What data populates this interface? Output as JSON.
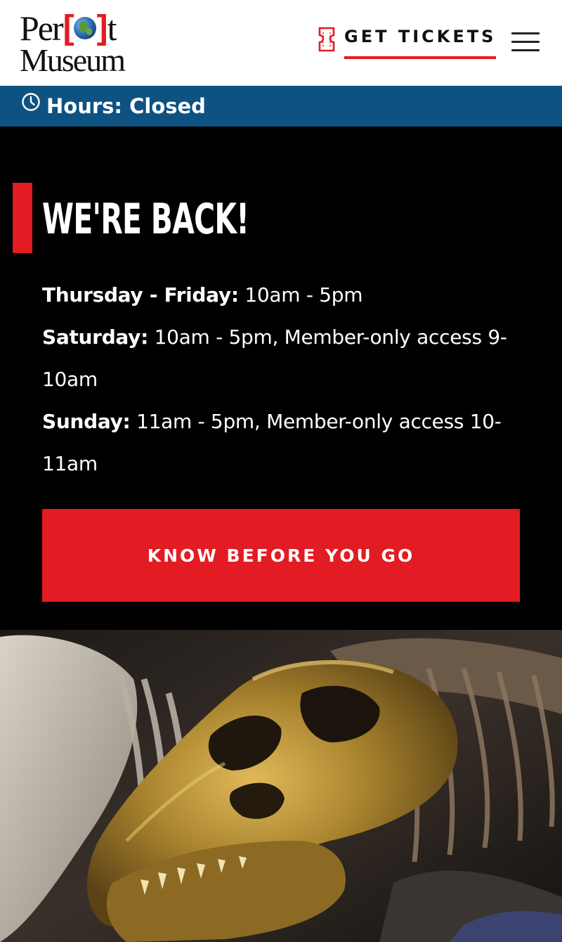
{
  "header": {
    "logo": {
      "line1_a": "Per",
      "line1_b": "t",
      "bracket_left": "[",
      "bracket_right": "]",
      "line2": "Museum"
    },
    "tickets_label": "GET TICKETS",
    "tickets_icon": "ticket-icon",
    "menu_icon": "hamburger-menu-icon"
  },
  "hours_bar": {
    "icon": "clock-icon",
    "text": "Hours: Closed"
  },
  "promo": {
    "title": "WE'RE BACK!",
    "schedule": [
      {
        "day": "Thursday - Friday:",
        "hours": " 10am - 5pm"
      },
      {
        "day": "Saturday:",
        "hours": " 10am - 5pm, Member-only access 9-10am"
      },
      {
        "day": "Sunday:",
        "hours": " 11am - 5pm, Member-only access 10-11am"
      }
    ],
    "cta_label": "KNOW BEFORE YOU GO"
  },
  "hero": {
    "subject": "dinosaur fossil skeleton exhibit"
  },
  "colors": {
    "brand_red": "#e31b23",
    "hours_blue": "#0e5282",
    "promo_bg": "#000000"
  }
}
